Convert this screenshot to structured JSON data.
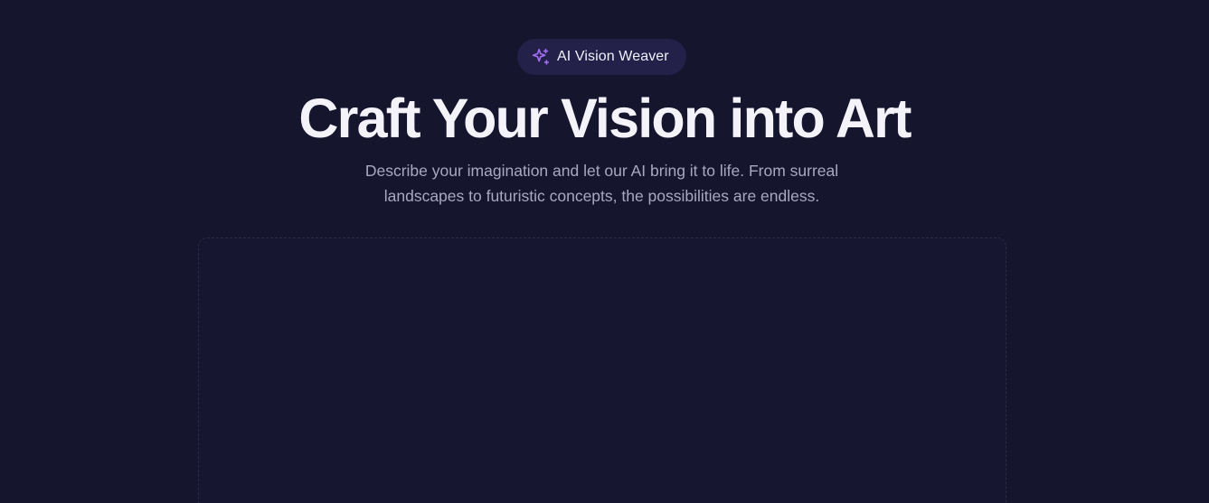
{
  "badge": {
    "icon": "sparkles-icon",
    "label": "AI Vision Weaver",
    "accent": "#a06cf0"
  },
  "hero": {
    "title": "Craft Your Vision into Art",
    "subtitle": "Describe your imagination and let our AI bring it to life. From surreal landscapes to futuristic concepts, the possibilities are endless."
  },
  "colors": {
    "background": "#16152e",
    "badge_background": "#23214a",
    "title": "#f4f3fa",
    "subtitle": "#a9a8c0",
    "dropzone_border": "#2b2a48"
  }
}
